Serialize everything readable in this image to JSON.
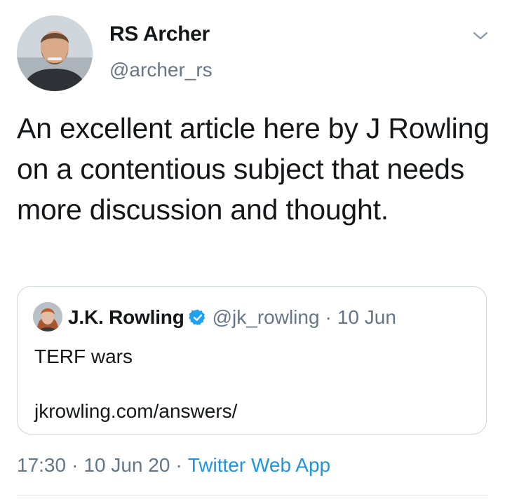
{
  "tweet": {
    "author": {
      "display_name": "RS Archer",
      "handle": "@archer_rs",
      "avatar_icon": "bearded-man-avatar"
    },
    "menu_icon": "chevron-down-icon",
    "text": "An excellent article here by J Rowling on a contentious subject that needs more discussion and thought.",
    "quoted": {
      "display_name": "J.K. Rowling",
      "verified_icon": "verified-badge-icon",
      "handle": "@jk_rowling",
      "separator": "·",
      "date": "10 Jun",
      "text": "TERF wars",
      "link": "jkrowling.com/answers/"
    },
    "meta": {
      "time": "17:30",
      "separator1": "·",
      "date": "10 Jun 20",
      "separator2": "·",
      "source": "Twitter Web App"
    }
  },
  "colors": {
    "text": "#14171a",
    "muted": "#657786",
    "accent": "#1b95e0",
    "border": "#ccd6dd",
    "verified": "#1da1f2"
  }
}
